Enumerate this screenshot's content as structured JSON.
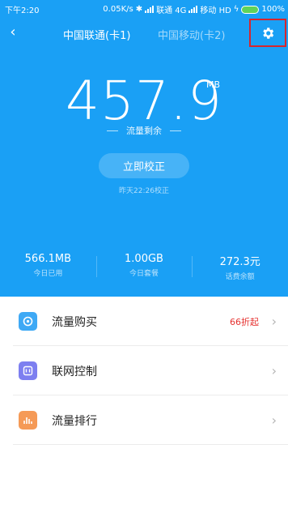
{
  "status_bar": {
    "time": "下午2:20",
    "net_speed": "0.05K/s",
    "carrier1": "联通 4G",
    "carrier2": "移动 HD",
    "battery": "100%",
    "battery_color": "#5fd35a"
  },
  "header": {
    "tabs": [
      {
        "label": "中国联通(卡1)",
        "active": true
      },
      {
        "label": "中国移动(卡2)",
        "active": false
      }
    ]
  },
  "usage": {
    "value": "457.9",
    "unit": "MB",
    "label": "流量剩余"
  },
  "calibrate": {
    "button": "立即校正",
    "last": "昨天22:26校正"
  },
  "stats": [
    {
      "value": "566.1MB",
      "label": "今日已用"
    },
    {
      "value": "1.00GB",
      "label": "今日套餐"
    },
    {
      "value": "272.3元",
      "label": "话费余额"
    }
  ],
  "menu": [
    {
      "label": "流量购买",
      "badge": "66折起",
      "icon": "data-purchase-icon",
      "color": "#3ea9f5"
    },
    {
      "label": "联网控制",
      "badge": "",
      "icon": "network-control-icon",
      "color": "#7d7ff0"
    },
    {
      "label": "流量排行",
      "badge": "",
      "icon": "data-ranking-icon",
      "color": "#f59a57"
    }
  ],
  "colors": {
    "accent": "#1aa0f5",
    "badge": "#e5312f",
    "highlight_box": "#d6262e"
  }
}
